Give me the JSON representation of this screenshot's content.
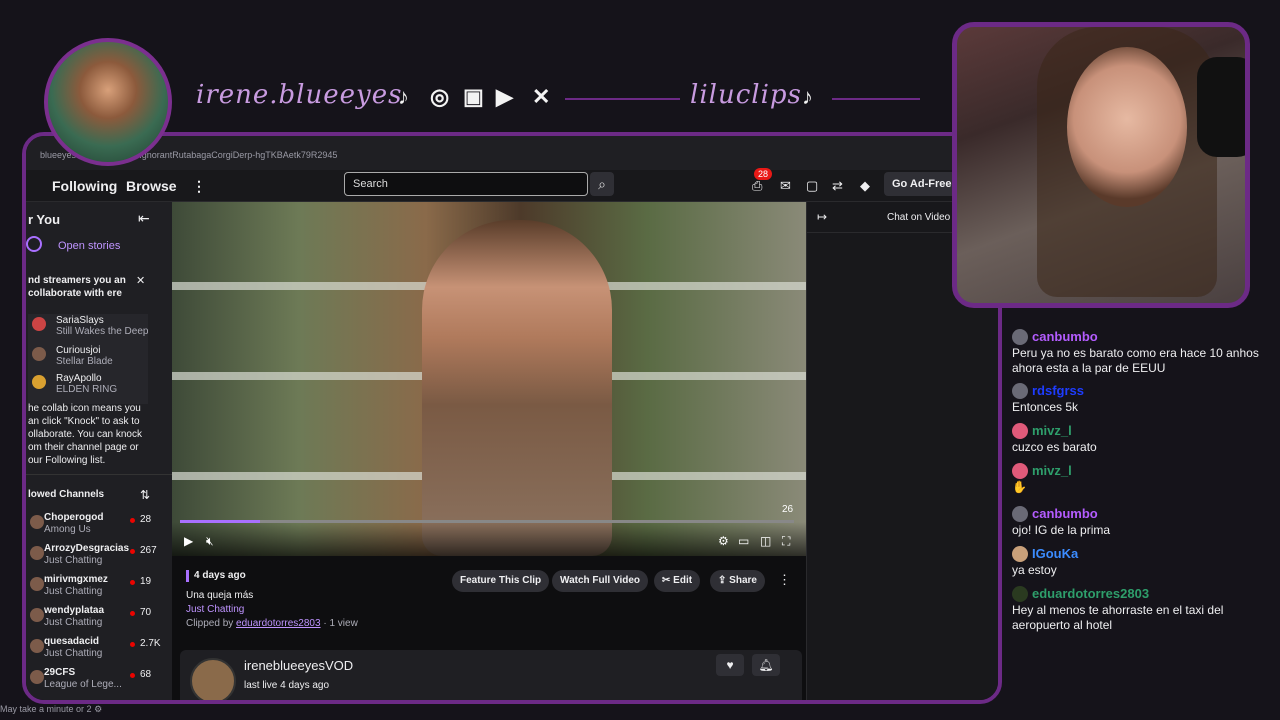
{
  "overlay": {
    "handle1": "irene.blueeyes",
    "handle2": "liluclips",
    "social_icons": [
      "tiktok-icon",
      "instagram-icon",
      "twitch-icon",
      "youtube-icon",
      "x-icon"
    ],
    "footer": "May take a minute or 2"
  },
  "browser": {
    "url": "blueeyesvod/clip/TubularIgnorantRutabagaCorgiDerp-hgTKBAetk79R2945",
    "nav": {
      "following": "Following",
      "browse": "Browse"
    },
    "search_placeholder": "Search",
    "notifications_badge": "28",
    "go_ad_free": "Go Ad-Free"
  },
  "sidebar": {
    "for_you": "r You",
    "open_stories": "Open stories",
    "collab_title": "nd streamers you an collaborate with ere",
    "suggested": [
      {
        "name": "SariaSlays",
        "category": "Still Wakes the Deep"
      },
      {
        "name": "Curiousjoi",
        "category": "Stellar Blade"
      },
      {
        "name": "RayApollo",
        "category": "ELDEN RING"
      }
    ],
    "collab_note": "he collab icon means you an click \"Knock\" to ask to ollaborate. You can knock om their channel page or our Following list.",
    "followed_header": "lowed Channels",
    "channels": [
      {
        "name": "Choperogod",
        "category": "Among Us",
        "viewers": "28"
      },
      {
        "name": "ArrozyDesgracias",
        "category": "Just Chatting",
        "viewers": "267"
      },
      {
        "name": "mirivmgxmez",
        "category": "Just Chatting",
        "viewers": "19"
      },
      {
        "name": "wendyplataa",
        "category": "Just Chatting",
        "viewers": "70"
      },
      {
        "name": "quesadacid",
        "category": "Just Chatting",
        "viewers": "2.7K"
      },
      {
        "name": "29CFS",
        "category": "League of Lege...",
        "viewers": "68"
      }
    ]
  },
  "video": {
    "timestamp": "26",
    "progress": 0.13
  },
  "clip": {
    "age": "4 days ago",
    "title": "Una queja más",
    "category": "Just Chatting",
    "clipped_by_prefix": "Clipped by",
    "clipper": "eduardotorres2803",
    "views": "· 1 view",
    "buttons": {
      "feature": "Feature This Clip",
      "watch_full": "Watch Full Video",
      "edit": "Edit",
      "share": "Share"
    },
    "channel": "ireneblueeyesVOD",
    "last_live": "last live 4 days ago"
  },
  "chat_panel": {
    "header": "Chat on Video"
  },
  "chat": [
    {
      "user": "canbumbo",
      "color": "#b45cff",
      "text": "Peru ya no es barato como era hace 10 anhos ahora esta a la par de EEUU"
    },
    {
      "user": "rdsfgrss",
      "color": "#1e3cff",
      "text": "Entonces 5k"
    },
    {
      "user": "mivz_l",
      "color": "#2e9e6b",
      "text": "cuzco es barato"
    },
    {
      "user": "mivz_l",
      "color": "#2e9e6b",
      "text": ""
    },
    {
      "user": "canbumbo",
      "color": "#b45cff",
      "text": "ojo! IG de la prima"
    },
    {
      "user": "IGouKa",
      "color": "#3c8cff",
      "text": "ya estoy"
    },
    {
      "user": "eduardotorres2803",
      "color": "#2e9e6b",
      "text": "Hey al menos te ahorraste en el taxi del aeropuerto al hotel"
    }
  ]
}
